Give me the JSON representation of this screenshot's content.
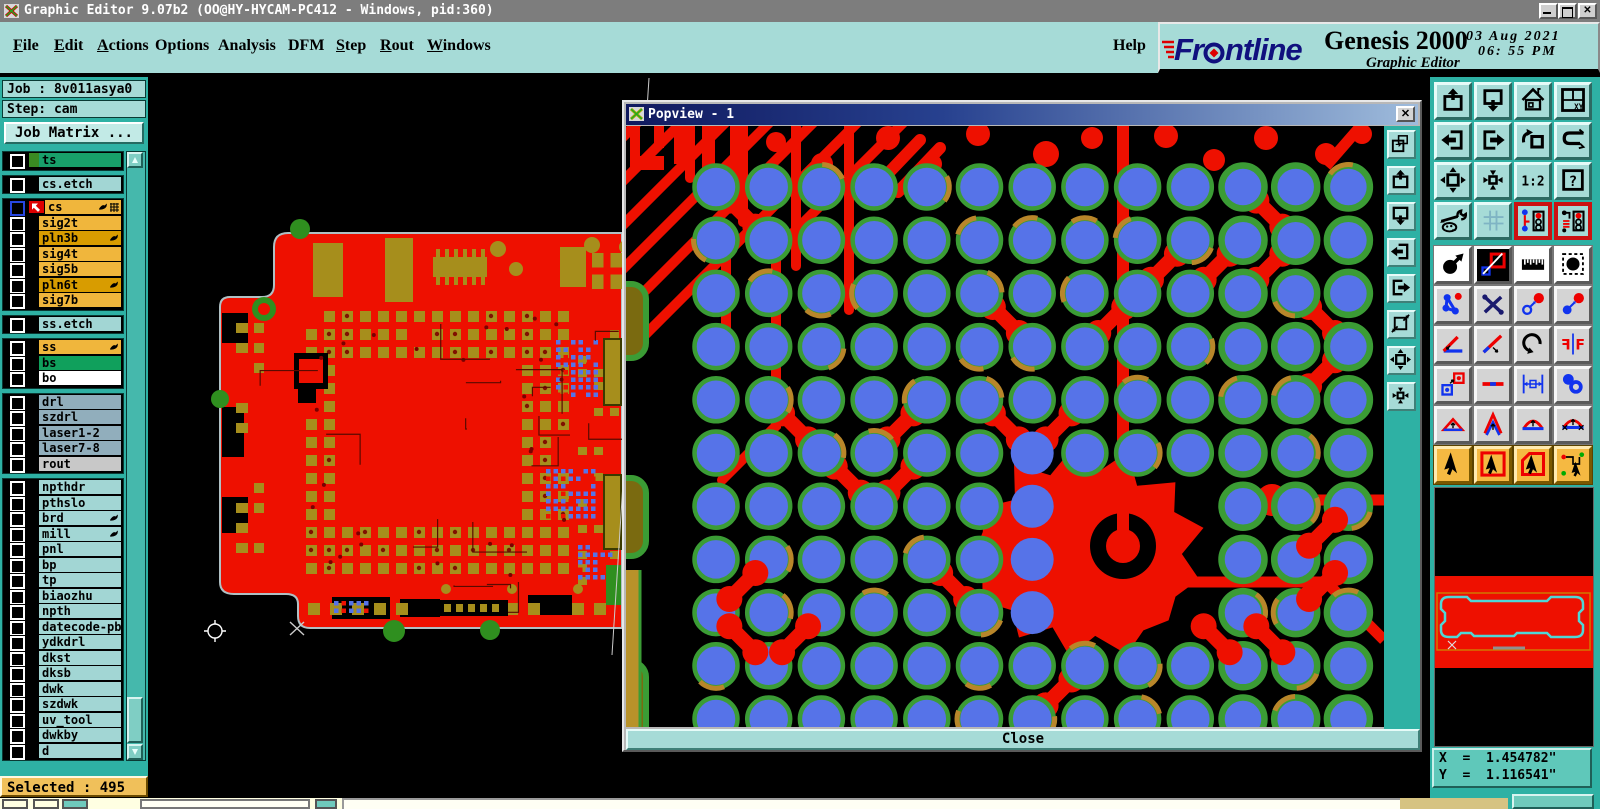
{
  "window": {
    "title": "Graphic Editor 9.07b2 (OO@HY-HYCAM-PC412 - Windows, pid:360)"
  },
  "menu": {
    "items": [
      {
        "label": "File",
        "underline": true
      },
      {
        "label": "Edit",
        "underline": true
      },
      {
        "label": "Actions",
        "underline": true
      },
      {
        "label": "Options",
        "underline": false
      },
      {
        "label": "Analysis",
        "underline": false
      },
      {
        "label": "DFM",
        "underline": false
      },
      {
        "label": "Step",
        "underline": true
      },
      {
        "label": "Rout",
        "underline": true
      },
      {
        "label": "Windows",
        "underline": true
      }
    ],
    "help": "Help"
  },
  "brand": {
    "logo": "Fr",
    "logo2": "ntline",
    "product": "Genesis 2000",
    "date": "03 Aug 2021",
    "time": "06: 55 PM",
    "app": "Graphic Editor"
  },
  "job": {
    "job": "Job : 8v011asya0",
    "step": "Step: cam",
    "matrix": "Job Matrix ..."
  },
  "layers": {
    "selected": "Selected : 495",
    "rows": [
      {
        "label": "ts",
        "bg": "#18a06a",
        "swatch": "#3a8a22",
        "group": 0
      },
      {
        "label": "cs.etch",
        "bg": "#a2d6d4",
        "group": 1
      },
      {
        "label": "cs",
        "bg": "#f0b63c",
        "group": 2,
        "active": true,
        "hand": true,
        "grid": true
      },
      {
        "label": "sig2t",
        "bg": "#f0b63c",
        "group": 2
      },
      {
        "label": "pln3b",
        "bg": "#d89c00",
        "group": 2,
        "hand": true
      },
      {
        "label": "sig4t",
        "bg": "#f0b63c",
        "group": 2
      },
      {
        "label": "sig5b",
        "bg": "#f0b63c",
        "group": 2
      },
      {
        "label": "pln6t",
        "bg": "#d89c00",
        "group": 2,
        "hand": true
      },
      {
        "label": "sig7b",
        "bg": "#f0b63c",
        "group": 2
      },
      {
        "label": "ss.etch",
        "bg": "#a2d6d4",
        "group": 3
      },
      {
        "label": "ss",
        "bg": "#f0b63c",
        "group": 4,
        "hand": true
      },
      {
        "label": "bs",
        "bg": "#10a05c",
        "group": 4
      },
      {
        "label": "bo",
        "bg": "#ffffff",
        "group": 4
      },
      {
        "label": "drl",
        "bg": "#91aebc",
        "group": 5
      },
      {
        "label": "szdrl",
        "bg": "#91aebc",
        "group": 5
      },
      {
        "label": "laser1-2",
        "bg": "#91aebc",
        "group": 5
      },
      {
        "label": "laser7-8",
        "bg": "#91aebc",
        "group": 5
      },
      {
        "label": "rout",
        "bg": "#c8c8c8",
        "group": 5
      },
      {
        "label": "npthdr",
        "bg": "#a2d6d4",
        "group": 6
      },
      {
        "label": "pthslo",
        "bg": "#a2d6d4",
        "group": 6
      },
      {
        "label": "brd",
        "bg": "#a2d6d4",
        "group": 6,
        "hand": true
      },
      {
        "label": "mill",
        "bg": "#a2d6d4",
        "group": 6,
        "hand": true
      },
      {
        "label": "pnl",
        "bg": "#a2d6d4",
        "group": 6
      },
      {
        "label": "bp",
        "bg": "#a2d6d4",
        "group": 6
      },
      {
        "label": "tp",
        "bg": "#a2d6d4",
        "group": 6
      },
      {
        "label": "biaozhu",
        "bg": "#a2d6d4",
        "group": 6
      },
      {
        "label": "npth",
        "bg": "#a2d6d4",
        "group": 6
      },
      {
        "label": "datecode-pb",
        "bg": "#a2d6d4",
        "group": 6
      },
      {
        "label": "ydkdrl",
        "bg": "#a2d6d4",
        "group": 6
      },
      {
        "label": "dkst",
        "bg": "#a2d6d4",
        "group": 6
      },
      {
        "label": "dksb",
        "bg": "#a2d6d4",
        "group": 6
      },
      {
        "label": "dwk",
        "bg": "#a2d6d4",
        "group": 6
      },
      {
        "label": "szdwk",
        "bg": "#a2d6d4",
        "group": 6
      },
      {
        "label": "uv_tool",
        "bg": "#a2d6d4",
        "group": 6
      },
      {
        "label": "dwkby",
        "bg": "#a2d6d4",
        "group": 6
      },
      {
        "label": "d",
        "bg": "#a2d6d4",
        "group": 6
      }
    ]
  },
  "popview": {
    "title": "Popview - 1",
    "close": "Close",
    "side_icons": [
      "win_copy",
      "paste_up",
      "win_down",
      "pan_left",
      "pan_right",
      "zoom_diag",
      "expand_out",
      "shrink_in"
    ]
  },
  "coords": {
    "x": "X  =  1.454782\"",
    "y": "Y  =  1.116541\""
  },
  "toolbar": {
    "rows": [
      {
        "style": "teal",
        "icons": [
          "paste_up",
          "win_down",
          "home",
          "tile_xy"
        ]
      },
      {
        "style": "teal",
        "icons": [
          "pan_left",
          "pan_right",
          "undo_box",
          "s_shape"
        ]
      },
      {
        "style": "teal",
        "icons": [
          "expand_out",
          "shrink_in",
          "ratio_12",
          "help_q"
        ]
      },
      {
        "style": "teal4",
        "icons": [
          "tools",
          "grid9",
          "stack_a",
          "stack_b"
        ]
      },
      {
        "style": "white",
        "icons": [
          "move_circle",
          "edit_squares",
          "ruler",
          "select_pad"
        ]
      },
      {
        "style": "gray",
        "icons": [
          "net_nodes",
          "delete_x",
          "grow_small",
          "grow_big"
        ]
      },
      {
        "style": "gray",
        "icons": [
          "angle",
          "slope",
          "rotate",
          "mirror_ff"
        ]
      },
      {
        "style": "gray",
        "icons": [
          "swap_squares",
          "dash_red",
          "measure_box",
          "merge_circles"
        ]
      },
      {
        "style": "gray",
        "icons": [
          "tri_1",
          "tri_2",
          "tri_3",
          "tri_4"
        ]
      },
      {
        "style": "gold",
        "icons": [
          "cursor",
          "cursor_box",
          "cursor_poly",
          "cursor_net"
        ]
      }
    ]
  },
  "colors": {
    "red": "#ee1000",
    "blue": "#5673e8",
    "green": "#3b9c35",
    "gold_arc": "#b8862a",
    "olive": "#a68e1c",
    "board_outline": "#b0c0c4",
    "teal": "#2eb1a4"
  }
}
